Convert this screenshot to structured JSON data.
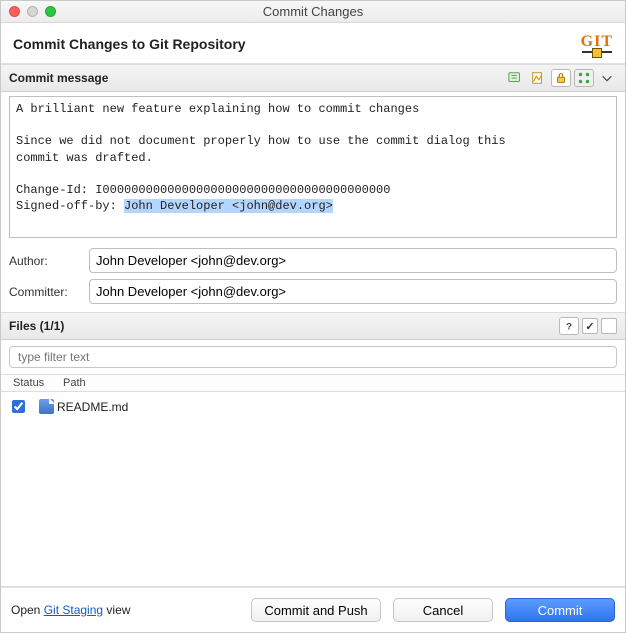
{
  "window": {
    "title": "Commit Changes"
  },
  "header": {
    "title": "Commit Changes to Git Repository",
    "logo_text": "GIT"
  },
  "sections": {
    "commit_label": "Commit message",
    "files_label": "Files (1/1)"
  },
  "message": {
    "line1": "A brilliant new feature explaining how to commit changes",
    "line2": "Since we did not document properly how to use the commit dialog this",
    "line3": "commit was drafted.",
    "line4": "Change-Id: I0000000000000000000000000000000000000000",
    "line5_prefix": "Signed-off-by: ",
    "line5_highlight": "John Developer <john@dev.org>"
  },
  "author": {
    "label": "Author:",
    "value": "John Developer <john@dev.org>"
  },
  "committer": {
    "label": "Committer:",
    "value": "John Developer <john@dev.org>"
  },
  "filter": {
    "placeholder": "type filter text"
  },
  "columns": {
    "status": "Status",
    "path": "Path"
  },
  "files": [
    {
      "checked": true,
      "path": "README.md"
    }
  ],
  "footer": {
    "open_prefix": "Open ",
    "open_link": "Git Staging",
    "open_suffix": " view",
    "commit_push": "Commit and Push",
    "cancel": "Cancel",
    "commit": "Commit"
  },
  "icons": {
    "amend": "amend-icon",
    "signoff": "signoff-icon",
    "lock": "lock-icon",
    "changeid": "changeid-icon",
    "menu": "chevron-down-icon",
    "help": "help-icon"
  }
}
